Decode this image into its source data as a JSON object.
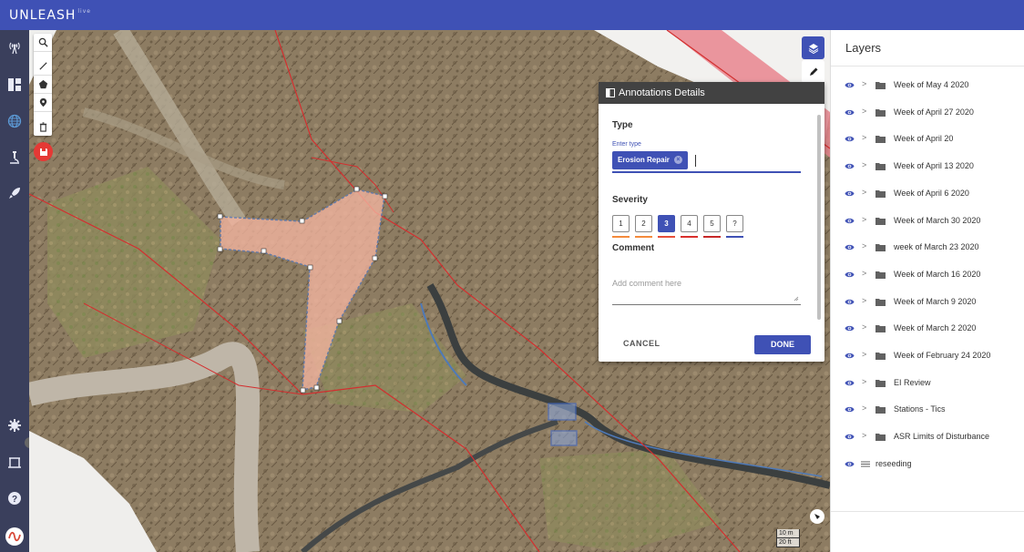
{
  "app": {
    "logo": "UNLEASH",
    "logo_suffix": "live"
  },
  "nav": {
    "items": [
      {
        "icon": "antenna-icon"
      },
      {
        "icon": "dashboard-icon"
      },
      {
        "icon": "globe-icon"
      },
      {
        "icon": "microscope-icon"
      },
      {
        "icon": "rocket-icon"
      },
      {
        "icon": "settings-icon"
      },
      {
        "icon": "survey-icon"
      },
      {
        "icon": "help-icon"
      },
      {
        "icon": "user-logo-icon"
      }
    ]
  },
  "map": {
    "tools": [
      "search-icon",
      "line-icon",
      "polygon-icon",
      "marker-icon",
      "delete-icon"
    ],
    "scale": {
      "metric": "10 m",
      "imperial": "20 ft"
    }
  },
  "dialog": {
    "title": "Annotations Details",
    "type_label": "Type",
    "enter_type_label": "Enter type",
    "type_chip": "Erosion Repair",
    "severity_label": "Severity",
    "severity_levels": [
      {
        "label": "1",
        "color": "#f48a3c"
      },
      {
        "label": "2",
        "color": "#f48a3c"
      },
      {
        "label": "3",
        "color": "#e8503a"
      },
      {
        "label": "4",
        "color": "#d9302c"
      },
      {
        "label": "5",
        "color": "#c62828"
      },
      {
        "label": "?",
        "color": "#3f51b5"
      }
    ],
    "selected_severity": "3",
    "comment_label": "Comment",
    "comment_placeholder": "Add comment here",
    "cancel_label": "CANCEL",
    "done_label": "DONE"
  },
  "layers": {
    "title": "Layers",
    "items": [
      {
        "label": "Week of May 4 2020",
        "kind": "folder"
      },
      {
        "label": "Week of April 27 2020",
        "kind": "folder"
      },
      {
        "label": "Week of April 20",
        "kind": "folder"
      },
      {
        "label": "Week of April 13 2020",
        "kind": "folder"
      },
      {
        "label": "Week of April 6 2020",
        "kind": "folder"
      },
      {
        "label": "Week of March 30 2020",
        "kind": "folder"
      },
      {
        "label": "week of March 23 2020",
        "kind": "folder"
      },
      {
        "label": "Week of March 16 2020",
        "kind": "folder"
      },
      {
        "label": "Week of March 9 2020",
        "kind": "folder"
      },
      {
        "label": "Week of March 2 2020",
        "kind": "folder"
      },
      {
        "label": "Week of February 24 2020",
        "kind": "folder"
      },
      {
        "label": "EI Review",
        "kind": "folder"
      },
      {
        "label": "Stations - Tics",
        "kind": "folder"
      },
      {
        "label": "ASR Limits of Disturbance",
        "kind": "folder"
      },
      {
        "label": "reseeding",
        "kind": "layer"
      }
    ]
  },
  "colors": {
    "primary": "#3f51b5",
    "nav_bg": "#3a3f5c",
    "boundary": "#d32f2f",
    "annotation_fill": "#f4b5a0",
    "save": "#e53935"
  }
}
